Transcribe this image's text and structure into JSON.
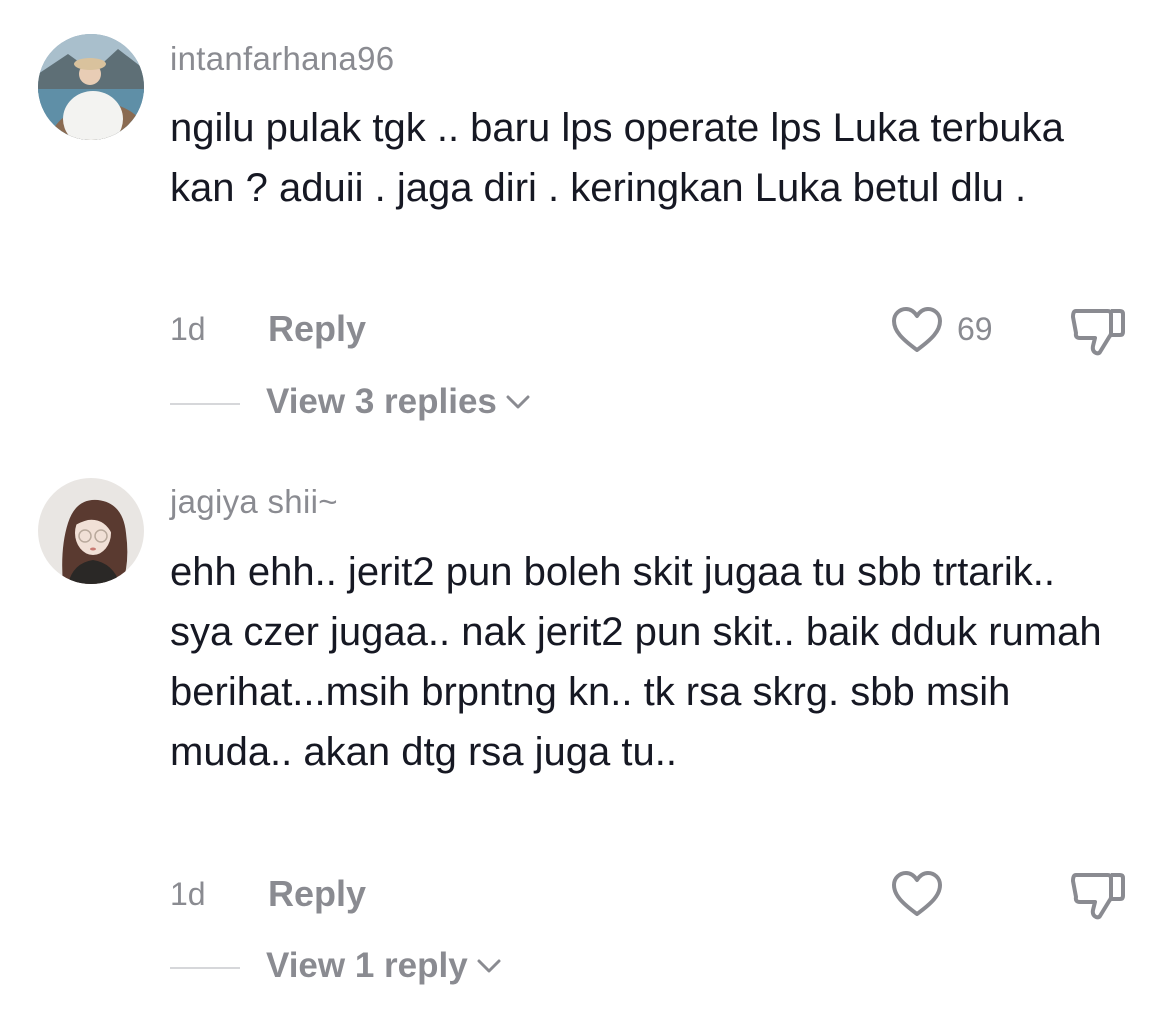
{
  "comments": [
    {
      "username": "intanfarhana96",
      "text": "ngilu pulak tgk .. baru lps operate lps Luka terbuka kan ? aduii . jaga diri . keringkan Luka betul dlu .",
      "time": "1d",
      "reply_label": "Reply",
      "like_count": "69",
      "view_replies_label": "View 3 replies",
      "avatar_icon": "user-avatar-photo"
    },
    {
      "username": "jagiya shii~",
      "text": "ehh ehh.. jerit2 pun boleh skit jugaa tu sbb trtarik.. sya czer jugaa.. nak jerit2 pun skit.. baik dduk rumah berihat...msih brpntng kn.. tk rsa skrg. sbb msih muda.. akan dtg rsa juga tu..",
      "time": "1d",
      "reply_label": "Reply",
      "like_count": "",
      "view_replies_label": "View 1 reply",
      "avatar_icon": "user-avatar-illustration"
    }
  ],
  "icons": {
    "like": "heart-outline-icon",
    "dislike": "thumbs-down-icon",
    "expand": "chevron-down-icon"
  },
  "colors": {
    "text_primary": "#161823",
    "text_secondary": "#8a8b91",
    "divider": "#d6d7da"
  }
}
